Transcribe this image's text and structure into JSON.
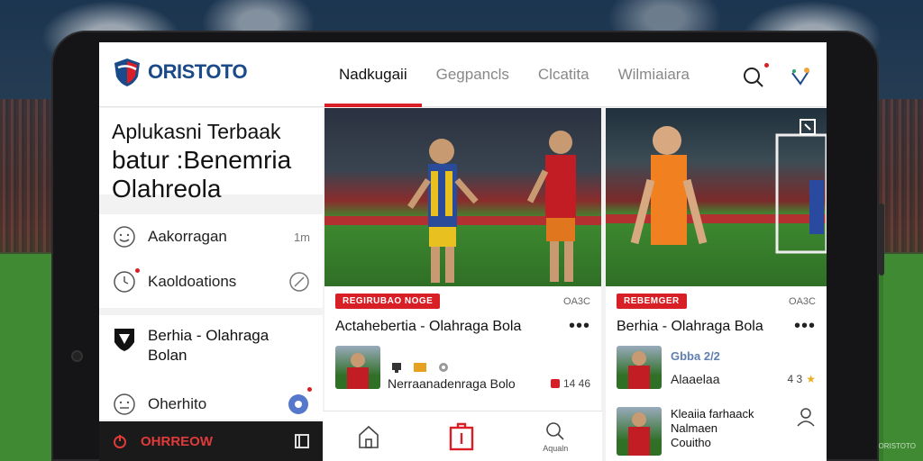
{
  "app": {
    "brand": "ORISTOTO",
    "watermark": "ORISTOTO"
  },
  "nav": {
    "tabs": [
      {
        "label": "Nadkugaii",
        "active": true
      },
      {
        "label": "Gegpancls",
        "active": false
      },
      {
        "label": "Clcatita",
        "active": false
      },
      {
        "label": "Wilmiaiara",
        "active": false
      }
    ]
  },
  "top_icons": [
    "search-icon",
    "share-icon"
  ],
  "sidebar": {
    "hero_line1": "Aplukasni Terbaak",
    "hero_line2": "batur :Benemria",
    "hero_line3": "Olahreola",
    "items": [
      {
        "label": "Aakorragan",
        "meta": "1m",
        "icon": "smiley-icon"
      },
      {
        "label": "Kaoldoations",
        "meta": "",
        "icon": "clock-icon"
      }
    ],
    "league_title_line1": "Berhia - Olahraga",
    "league_title_line2": "Bolan",
    "bottom_item": {
      "label": "Oherhito",
      "icon": "smiley-icon"
    },
    "footer_label": "OHRREOW"
  },
  "cards": [
    {
      "badge": "REGIRUBAO NOGE",
      "count": "OA3C",
      "title": "Actahebertia - Olahraga Bola",
      "sub_text": "Nerraanadenraga Bolo",
      "stat": "14 46"
    },
    {
      "badge": "REBEMGER",
      "count": "OA3C",
      "title": "Berhia - Olahraga Bola",
      "sub_heading": "Gbba 2/2",
      "sub_text": "Alaaelaa",
      "stat": "4 3",
      "second_line1": "Kleaiia farhaack",
      "second_line2": "Nalmaen",
      "second_line3": "Couitho"
    }
  ],
  "bottom_bar": {
    "items": [
      {
        "label": "",
        "icon": "home-icon"
      },
      {
        "label": "",
        "icon": "bag-icon"
      },
      {
        "label": "Aqualn",
        "icon": "search-icon"
      }
    ]
  },
  "colors": {
    "accent": "#d91f26",
    "brand": "#1b4a8a"
  }
}
